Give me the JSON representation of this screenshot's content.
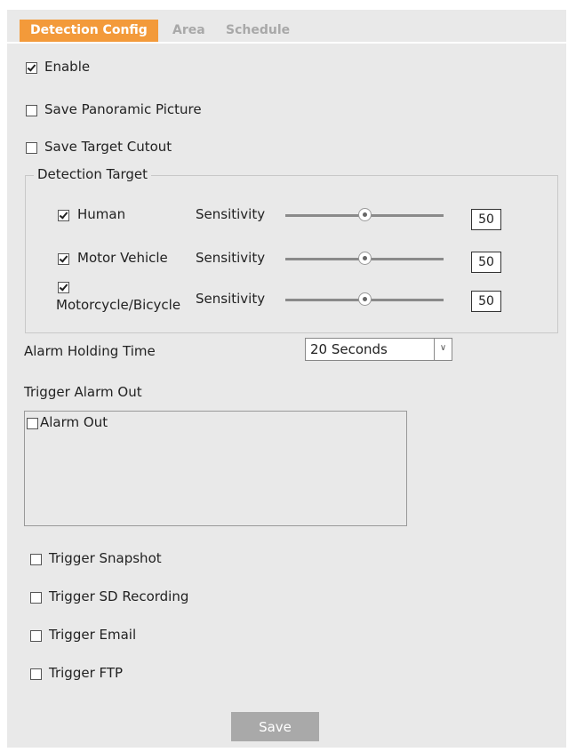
{
  "tabs": [
    {
      "label": "Detection Config",
      "active": true
    },
    {
      "label": "Area",
      "active": false
    },
    {
      "label": "Schedule",
      "active": false
    }
  ],
  "options": {
    "enable": {
      "label": "Enable",
      "checked": true
    },
    "save_panoramic": {
      "label": "Save Panoramic Picture",
      "checked": false
    },
    "save_target_cutout": {
      "label": "Save Target Cutout",
      "checked": false
    }
  },
  "detection_target": {
    "legend": "Detection Target",
    "sensitivity_label": "Sensitivity",
    "targets": [
      {
        "label": "Human",
        "checked": true,
        "sensitivity": 50
      },
      {
        "label": "Motor Vehicle",
        "checked": true,
        "sensitivity": 50
      },
      {
        "label": "Motorcycle/Bicycle",
        "checked": true,
        "sensitivity": 50
      }
    ]
  },
  "alarm_holding": {
    "label": "Alarm Holding Time",
    "value": "20 Seconds"
  },
  "trigger_alarm_out": {
    "label": "Trigger Alarm Out",
    "items": [
      {
        "label": "Alarm Out",
        "checked": false
      }
    ]
  },
  "triggers": [
    {
      "label": "Trigger Snapshot",
      "checked": false
    },
    {
      "label": "Trigger SD Recording",
      "checked": false
    },
    {
      "label": "Trigger Email",
      "checked": false
    },
    {
      "label": "Trigger FTP",
      "checked": false
    }
  ],
  "save_label": "Save",
  "colors": {
    "accent": "#f39a3a",
    "panel_bg": "#e9e9e9",
    "button_bg": "#a9a9a9"
  }
}
